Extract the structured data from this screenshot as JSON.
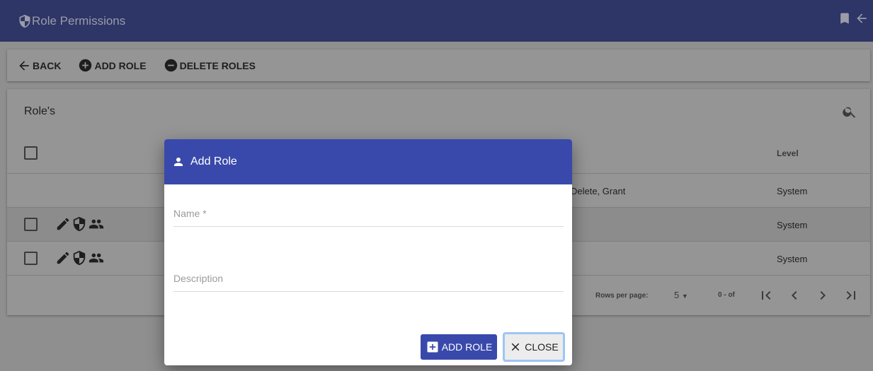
{
  "appbar": {
    "title": "Role Permissions",
    "icons": [
      "shield-icon",
      "bookmark-icon",
      "arrow-back-icon"
    ]
  },
  "toolbar": {
    "back": "BACK",
    "add_role": "ADD ROLE",
    "delete_roles": "DELETE ROLES"
  },
  "table": {
    "title": "Role's",
    "columns": {
      "level": "Level"
    },
    "rows": [
      {
        "permissions": "Delete, Grant",
        "level": "System"
      },
      {
        "level": "System"
      },
      {
        "level": "System"
      }
    ],
    "footer": {
      "rows_per_page_label": "Rows per page:",
      "rows_per_page": "5",
      "range": "0 - of"
    }
  },
  "dialog": {
    "title": "Add Role",
    "name_label": "Name *",
    "description_label": "Description",
    "add_button": "ADD ROLE",
    "close_button": "CLOSE"
  },
  "colors": {
    "appbar": "#2e3567",
    "dialog_header": "#3949ab",
    "primary_button": "#3949ab"
  }
}
